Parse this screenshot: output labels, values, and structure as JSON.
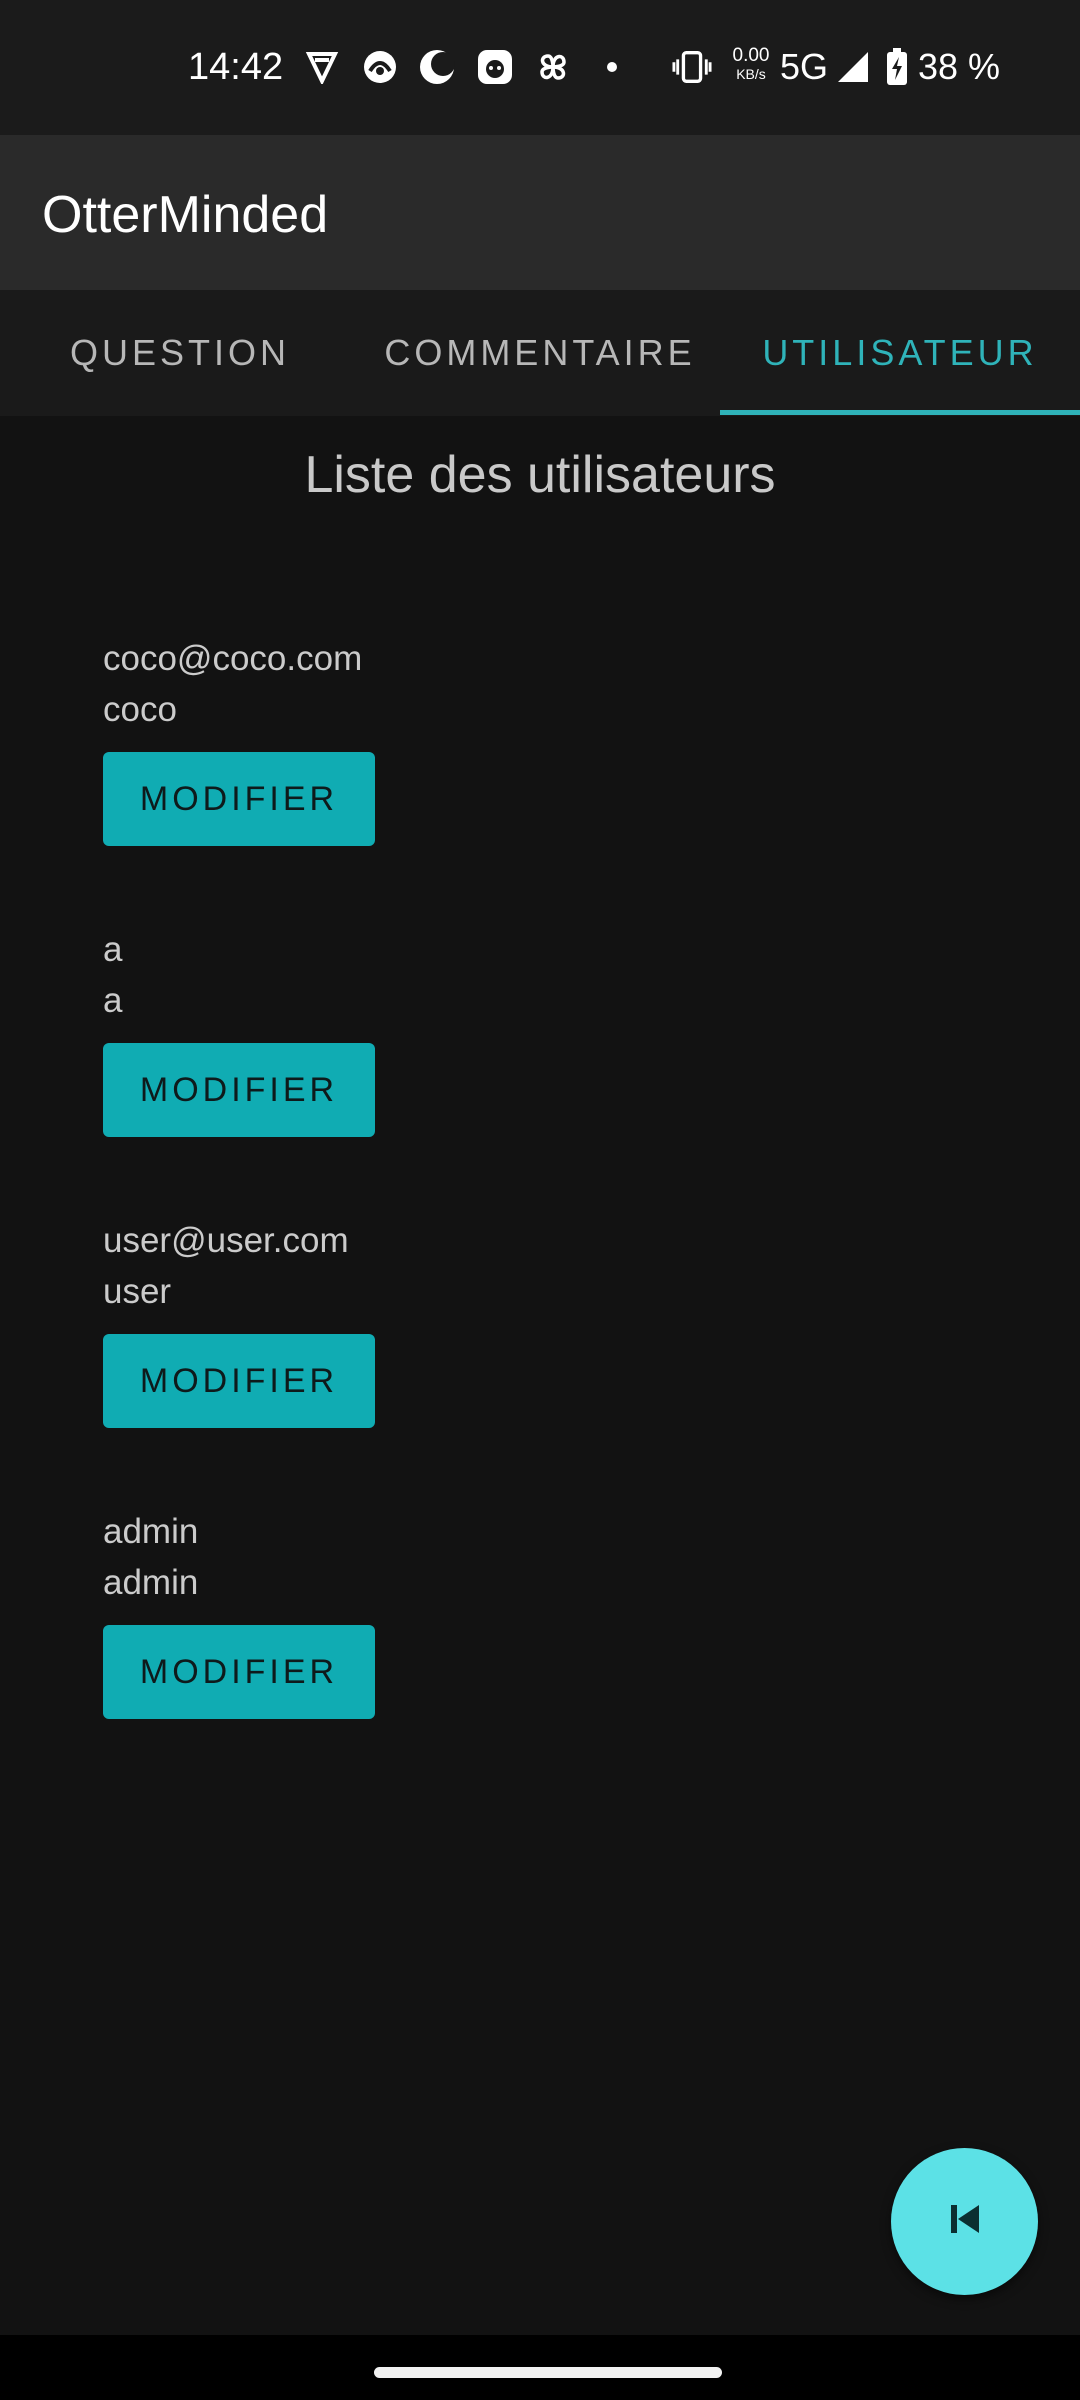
{
  "status_bar": {
    "time": "14:42",
    "icons": [
      "vpn-shield-icon",
      "app-notification-icon",
      "moon-icon",
      "app-face-icon",
      "pinwheel-icon",
      "dot-icon",
      "vibrate-icon"
    ],
    "net_speed_value": "0.00",
    "net_speed_unit": "KB/s",
    "network": "5G",
    "signal_icon": "signal-icon",
    "battery_icon": "battery-charging-icon",
    "battery_percent": "38 %"
  },
  "app_bar": {
    "title": "OtterMinded"
  },
  "tabs": [
    {
      "label": "QUESTION",
      "active": false
    },
    {
      "label": "COMMENTAIRE",
      "active": false
    },
    {
      "label": "UTILISATEUR",
      "active": true
    }
  ],
  "main": {
    "title": "Liste des utilisateurs",
    "users": [
      {
        "email": "coco@coco.com",
        "name": "coco",
        "button_label": "MODIFIER"
      },
      {
        "email": "a",
        "name": "a",
        "button_label": "MODIFIER"
      },
      {
        "email": "user@user.com",
        "name": "user",
        "button_label": "MODIFIER"
      },
      {
        "email": "admin",
        "name": "admin",
        "button_label": "MODIFIER"
      }
    ]
  },
  "fab": {
    "icon": "skip-previous-icon"
  },
  "colors": {
    "background": "#121212",
    "accent": "#2fb3b9",
    "button": "#10acb3",
    "fab": "#5ce1e6",
    "app_bar": "#2a2a2a"
  }
}
